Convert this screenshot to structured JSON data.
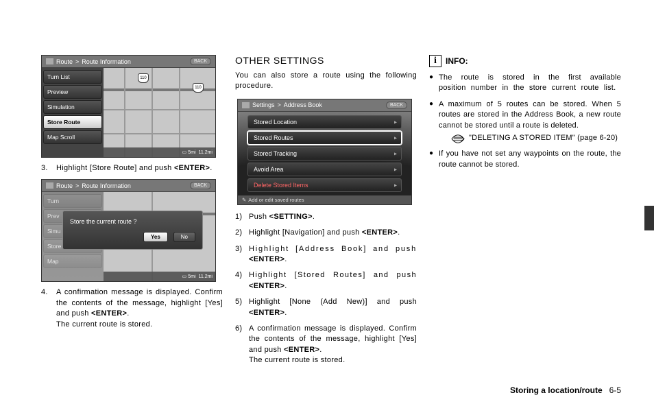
{
  "screen1": {
    "breadcrumb_icon": "nav-icon",
    "breadcrumb_a": "Route",
    "breadcrumb_sep": ">",
    "breadcrumb_b": "Route Information",
    "back": "BACK",
    "menu": [
      "Turn List",
      "Preview",
      "Simulation",
      "Store Route",
      "Map Scroll"
    ],
    "selected_index": 3,
    "shields": [
      "110",
      "110"
    ],
    "map_footer_scale": "5mi",
    "map_footer_dist": "11.2mi"
  },
  "step3": {
    "num": "3.",
    "text_a": "Highlight [Store Route] and push ",
    "text_b": "<ENTER>",
    "text_c": "."
  },
  "screen2": {
    "breadcrumb_a": "Route",
    "breadcrumb_sep": ">",
    "breadcrumb_b": "Route Information",
    "back": "BACK",
    "dialog_text": "Store the current route ?",
    "yes": "Yes",
    "no": "No",
    "map_footer_scale": "5mi",
    "map_footer_dist": "11.2mi"
  },
  "step4": {
    "num": "4.",
    "line1_a": "A confirmation message is displayed. Confirm the contents of the message, highlight [Yes] and push ",
    "line1_b": "<ENTER>",
    "line1_c": ".",
    "line2": "The current route is stored."
  },
  "col2": {
    "heading": "OTHER SETTINGS",
    "intro": "You can also store a route using the following procedure."
  },
  "screen3": {
    "breadcrumb_a": "Settings",
    "breadcrumb_sep": ">",
    "breadcrumb_b": "Address Book",
    "back": "BACK",
    "items": [
      "Stored Location",
      "Stored Routes",
      "Stored Tracking",
      "Avoid Area",
      "Delete Stored Items"
    ],
    "selected_index": 1,
    "footer_icon": "pencil",
    "footer_text": "Add or edit saved routes"
  },
  "steps_col2": [
    {
      "num": "1)",
      "parts": [
        "Push ",
        "<SETTING>",
        "."
      ]
    },
    {
      "num": "2)",
      "parts": [
        "Highlight [Navigation] and push ",
        "<ENTER>",
        "."
      ]
    },
    {
      "num": "3)",
      "parts": [
        "Highlight [Address Book] and push ",
        "<ENTER>",
        "."
      ]
    },
    {
      "num": "4)",
      "parts": [
        "Highlight [Stored Routes] and push ",
        "<ENTER>",
        "."
      ]
    },
    {
      "num": "5)",
      "parts": [
        "Highlight [None (Add New)] and push ",
        "<ENTER>",
        "."
      ]
    },
    {
      "num": "6)",
      "parts": [
        "A confirmation message is displayed. Confirm the contents of the message, highlight [Yes] and push ",
        "<ENTER>",
        "."
      ],
      "line2": "The current route is stored."
    }
  ],
  "info": {
    "icon_glyph": "i",
    "title": "INFO:",
    "bullets": [
      {
        "text": "The route is stored in the first available position number in the store current route list."
      },
      {
        "text": "A maximum of 5 routes can be stored. When 5 routes are stored in the Address Book, a new route cannot be stored until a route is deleted.",
        "xref": "\"DELETING A STORED ITEM\" (page 6-20)"
      },
      {
        "text": "If you have not set any waypoints on the route, the route cannot be stored."
      }
    ]
  },
  "footer": {
    "title": "Storing a location/route",
    "page": "6-5"
  }
}
